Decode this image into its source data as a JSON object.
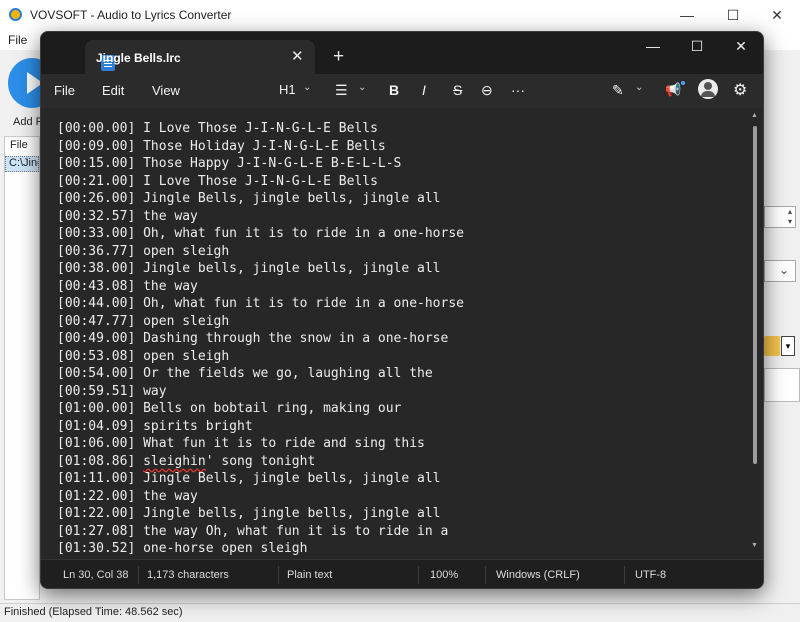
{
  "background_app": {
    "title": "VOVSOFT - Audio to Lyrics Converter",
    "menu_file": "File",
    "add_label": "Add F",
    "list_header": "File",
    "list_row": "C:\\Jing",
    "status": "Finished (Elapsed Time: 48.562 sec)",
    "controls": {
      "minimize": "—",
      "maximize": "☐",
      "close": "✕"
    }
  },
  "notepad": {
    "tab": {
      "title": "Jingle Bells.lrc",
      "close": "✕",
      "new_tab": "+"
    },
    "controls": {
      "minimize": "—",
      "maximize": "☐",
      "close": "✕"
    },
    "menu": {
      "file": "File",
      "edit": "Edit",
      "view": "View"
    },
    "toolbar": {
      "heading": "H1",
      "chevron": "⌄",
      "list": "☰",
      "bold": "B",
      "italic": "I",
      "strike": "S",
      "link": "⊖",
      "more": "···",
      "copilot": "✎",
      "announce": "📢",
      "settings": "⚙"
    },
    "lines": [
      "[00:00.00] I Love Those J-I-N-G-L-E Bells",
      "[00:09.00] Those Holiday J-I-N-G-L-E Bells",
      "[00:15.00] Those Happy J-I-N-G-L-E B-E-L-L-S",
      "[00:21.00] I Love Those J-I-N-G-L-E Bells",
      "[00:26.00] Jingle Bells, jingle bells, jingle all",
      "[00:32.57] the way",
      "[00:33.00] Oh, what fun it is to ride in a one-horse",
      "[00:36.77] open sleigh",
      "[00:38.00] Jingle bells, jingle bells, jingle all",
      "[00:43.08] the way",
      "[00:44.00] Oh, what fun it is to ride in a one-horse",
      "[00:47.77] open sleigh",
      "[00:49.00] Dashing through the snow in a one-horse",
      "[00:53.08] open sleigh",
      "[00:54.00] Or the fields we go, laughing all the",
      "[00:59.51] way",
      "[01:00.00] Bells on bobtail ring, making our",
      "[01:04.09] spirits bright",
      "[01:06.00] What fun it is to ride and sing this",
      "[01:08.86] sleighin' song tonight",
      "[01:11.00] Jingle Bells, jingle bells, jingle all",
      "[01:22.00] the way",
      "[01:22.00] Jingle bells, jingle bells, jingle all",
      "[01:27.08] the way Oh, what fun it is to ride in a",
      "[01:30.52] one-horse open sleigh"
    ],
    "status": {
      "position": "Ln 30, Col 38",
      "characters": "1,173 characters",
      "format": "Plain text",
      "zoom": "100%",
      "line_ending": "Windows (CRLF)",
      "encoding": "UTF-8"
    }
  }
}
